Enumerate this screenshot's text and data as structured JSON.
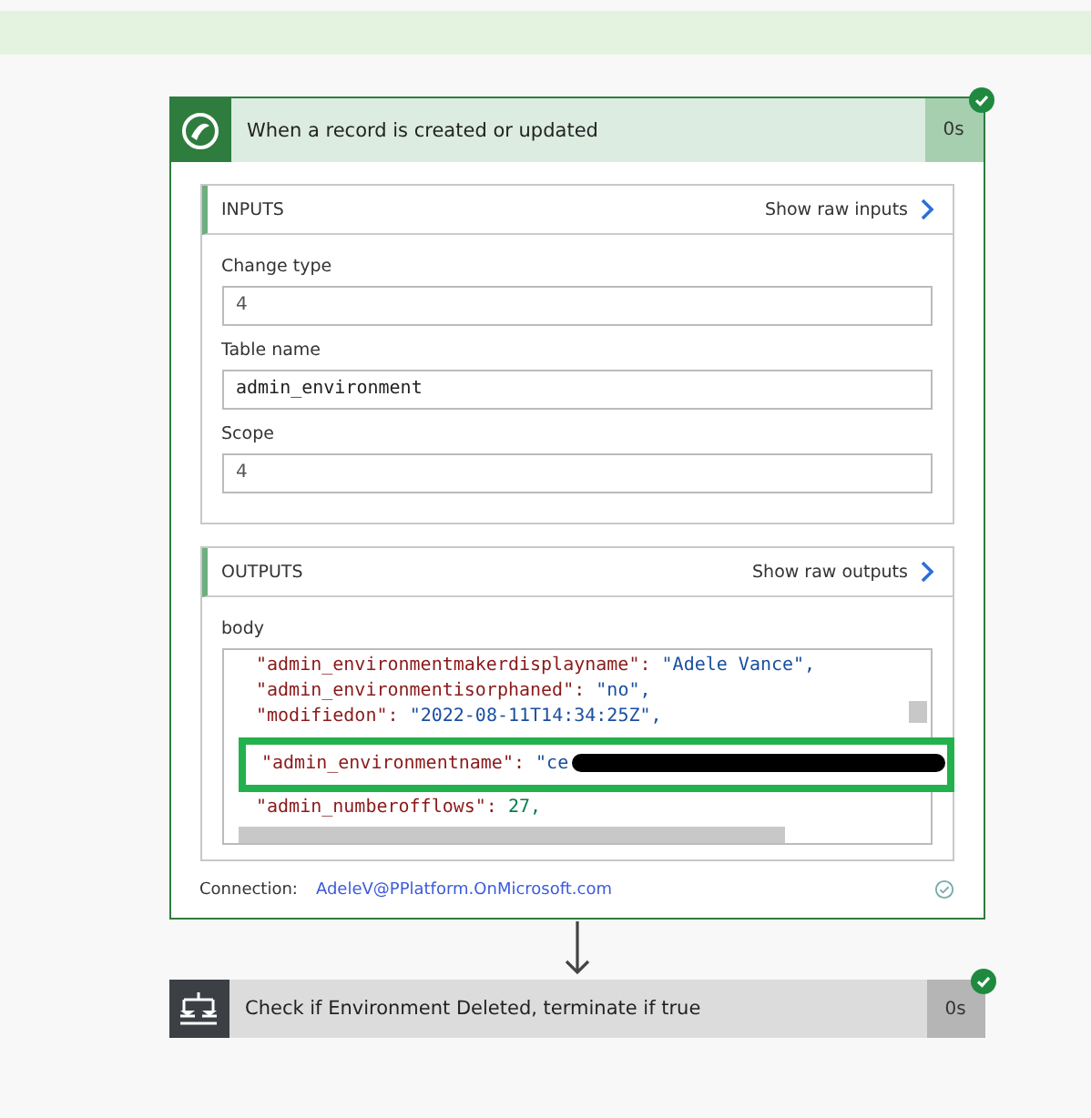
{
  "trigger": {
    "title": "When a record is created or updated",
    "duration": "0s",
    "succeeded": true
  },
  "inputs": {
    "heading": "INPUTS",
    "raw_link": "Show raw inputs",
    "fields": [
      {
        "label": "Change type",
        "value": "4"
      },
      {
        "label": "Table name",
        "value": "admin_environment"
      },
      {
        "label": "Scope",
        "value": "4"
      }
    ]
  },
  "outputs": {
    "heading": "OUTPUTS",
    "raw_link": "Show raw outputs",
    "body_label": "body",
    "lines": [
      {
        "key": "\"admin_environmentmakerdisplayname\":",
        "value": "\"Adele Vance\",",
        "kind": "string",
        "redacted": false,
        "highlighted": false
      },
      {
        "key": "\"admin_environmentisorphaned\":",
        "value": "\"no\",",
        "kind": "string",
        "redacted": false,
        "highlighted": false
      },
      {
        "key": "\"modifiedon\":",
        "value": "\"2022-08-11T14:34:25Z\",",
        "kind": "string",
        "redacted": false,
        "highlighted": false
      },
      {
        "key": "\"admin_environmentname\":",
        "value": "\"ce",
        "kind": "string",
        "redacted": true,
        "highlighted": true
      },
      {
        "key": "\"admin_numberofflows\":",
        "value": "27,",
        "kind": "number",
        "redacted": false,
        "highlighted": false
      }
    ]
  },
  "connection": {
    "label": "Connection:",
    "account": "AdeleV@PPlatform.OnMicrosoft.com"
  },
  "next_step": {
    "title": "Check if Environment Deleted, terminate if true",
    "duration": "0s",
    "succeeded": true
  }
}
